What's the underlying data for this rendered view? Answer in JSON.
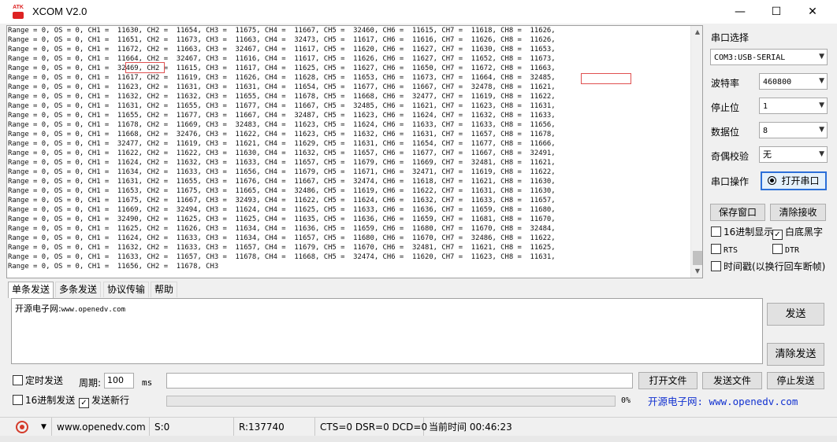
{
  "window": {
    "title": "XCOM V2.0",
    "icon_text": "ATK",
    "minimize": "—",
    "maximize": "☐",
    "close": "✕"
  },
  "receive": {
    "lines": [
      "Range = 0, OS = 0, CH1 =  11630, CH2 =  11654, CH3 =  11675, CH4 =  11667, CH5 =  32460, CH6 =  11615, CH7 =  11618, CH8 =  11626,",
      "Range = 0, OS = 0, CH1 =  11651, CH2 =  11673, CH3 =  11663, CH4 =  32473, CH5 =  11617, CH6 =  11616, CH7 =  11626, CH8 =  11626,",
      "Range = 0, OS = 0, CH1 =  11672, CH2 =  11663, CH3 =  32467, CH4 =  11617, CH5 =  11620, CH6 =  11627, CH7 =  11630, CH8 =  11653,",
      "Range = 0, OS = 0, CH1 =  11664, CH2 =  32467, CH3 =  11616, CH4 =  11617, CH5 =  11626, CH6 =  11627, CH7 =  11652, CH8 =  11673,",
      "Range = 0, OS = 0, CH1 =  32469, CH2 =  11615, CH3 =  11617, CH4 =  11625, CH5 =  11627, CH6 =  11650, CH7 =  11672, CH8 =  11663,",
      "Range = 0, OS = 0, CH1 =  11617, CH2 =  11619, CH3 =  11626, CH4 =  11628, CH5 =  11653, CH6 =  11673, CH7 =  11664, CH8 =  32485,",
      "Range = 0, OS = 0, CH1 =  11623, CH2 =  11631, CH3 =  11631, CH4 =  11654, CH5 =  11677, CH6 =  11667, CH7 =  32478, CH8 =  11621,",
      "Range = 0, OS = 0, CH1 =  11632, CH2 =  11632, CH3 =  11655, CH4 =  11678, CH5 =  11668, CH6 =  32477, CH7 =  11619, CH8 =  11622,",
      "Range = 0, OS = 0, CH1 =  11631, CH2 =  11655, CH3 =  11677, CH4 =  11667, CH5 =  32485, CH6 =  11621, CH7 =  11623, CH8 =  11631,",
      "Range = 0, OS = 0, CH1 =  11655, CH2 =  11677, CH3 =  11667, CH4 =  32487, CH5 =  11623, CH6 =  11624, CH7 =  11632, CH8 =  11633,",
      "Range = 0, OS = 0, CH1 =  11678, CH2 =  11669, CH3 =  32483, CH4 =  11623, CH5 =  11624, CH6 =  11633, CH7 =  11633, CH8 =  11656,",
      "Range = 0, OS = 0, CH1 =  11668, CH2 =  32476, CH3 =  11622, CH4 =  11623, CH5 =  11632, CH6 =  11631, CH7 =  11657, CH8 =  11678,",
      "Range = 0, OS = 0, CH1 =  32477, CH2 =  11619, CH3 =  11621, CH4 =  11629, CH5 =  11631, CH6 =  11654, CH7 =  11677, CH8 =  11666,",
      "Range = 0, OS = 0, CH1 =  11622, CH2 =  11622, CH3 =  11630, CH4 =  11632, CH5 =  11657, CH6 =  11677, CH7 =  11667, CH8 =  32491,",
      "Range = 0, OS = 0, CH1 =  11624, CH2 =  11632, CH3 =  11633, CH4 =  11657, CH5 =  11679, CH6 =  11669, CH7 =  32481, CH8 =  11621,",
      "Range = 0, OS = 0, CH1 =  11634, CH2 =  11633, CH3 =  11656, CH4 =  11679, CH5 =  11671, CH6 =  32471, CH7 =  11619, CH8 =  11622,",
      "Range = 0, OS = 0, CH1 =  11631, CH2 =  11655, CH3 =  11676, CH4 =  11667, CH5 =  32474, CH6 =  11618, CH7 =  11621, CH8 =  11630,",
      "Range = 0, OS = 0, CH1 =  11653, CH2 =  11675, CH3 =  11665, CH4 =  32486, CH5 =  11619, CH6 =  11622, CH7 =  11631, CH8 =  11630,",
      "Range = 0, OS = 0, CH1 =  11675, CH2 =  11667, CH3 =  32493, CH4 =  11622, CH5 =  11624, CH6 =  11632, CH7 =  11633, CH8 =  11657,",
      "Range = 0, OS = 0, CH1 =  11669, CH2 =  32494, CH3 =  11624, CH4 =  11625, CH5 =  11633, CH6 =  11636, CH7 =  11659, CH8 =  11680,",
      "Range = 0, OS = 0, CH1 =  32490, CH2 =  11625, CH3 =  11625, CH4 =  11635, CH5 =  11636, CH6 =  11659, CH7 =  11681, CH8 =  11670,",
      "Range = 0, OS = 0, CH1 =  11625, CH2 =  11626, CH3 =  11634, CH4 =  11636, CH5 =  11659, CH6 =  11680, CH7 =  11670, CH8 =  32484,",
      "Range = 0, OS = 0, CH1 =  11624, CH2 =  11633, CH3 =  11634, CH4 =  11657, CH5 =  11680, CH6 =  11670, CH7 =  32486, CH8 =  11622,",
      "Range = 0, OS = 0, CH1 =  11632, CH2 =  11633, CH3 =  11657, CH4 =  11679, CH5 =  11670, CH6 =  32481, CH7 =  11621, CH8 =  11625,",
      "Range = 0, OS = 0, CH1 =  11633, CH2 =  11657, CH3 =  11678, CH4 =  11668, CH5 =  32474, CH6 =  11620, CH7 =  11623, CH8 =  11631,",
      "Range = 0, OS = 0, CH1 =  11656, CH2 =  11678, CH3"
    ]
  },
  "serial": {
    "port_label": "串口选择",
    "port_value": "COM3:USB-SERIAL",
    "baud_label": "波特率",
    "baud_value": "460800",
    "stop_label": "停止位",
    "stop_value": "1",
    "data_label": "数据位",
    "data_value": "8",
    "parity_label": "奇偶校验",
    "parity_value": "无",
    "op_label": "串口操作",
    "open_button": "打开串口"
  },
  "receive_controls": {
    "save_window": "保存窗口",
    "clear_receive": "清除接收",
    "hex_display": "16进制显示",
    "white_bg": "白底黑字",
    "rts": "RTS",
    "dtr": "DTR",
    "timestamp": "时间戳(以换行回车断帧)"
  },
  "tabs": [
    "单条发送",
    "多条发送",
    "协议传输",
    "帮助"
  ],
  "send": {
    "text_cn": "开源电子网:",
    "text_url": "www.openedv.com",
    "send_button": "发送",
    "clear_send_button": "清除发送",
    "timed_send": "定时发送",
    "period_label": "周期:",
    "period_value": "100",
    "period_unit": "ms",
    "hex_send": "16进制发送",
    "send_newline": "发送新行",
    "open_file": "打开文件",
    "send_file": "发送文件",
    "stop_send": "停止发送",
    "progress_text": "0%",
    "url_label": "开源电子网: www.openedv.com",
    "progress": 0
  },
  "statusbar": {
    "site": "www.openedv.com",
    "sent": "S:0",
    "received": "R:137740",
    "lines": "CTS=0 DSR=0 DCD=0",
    "time": "当前时间 00:46:23"
  }
}
